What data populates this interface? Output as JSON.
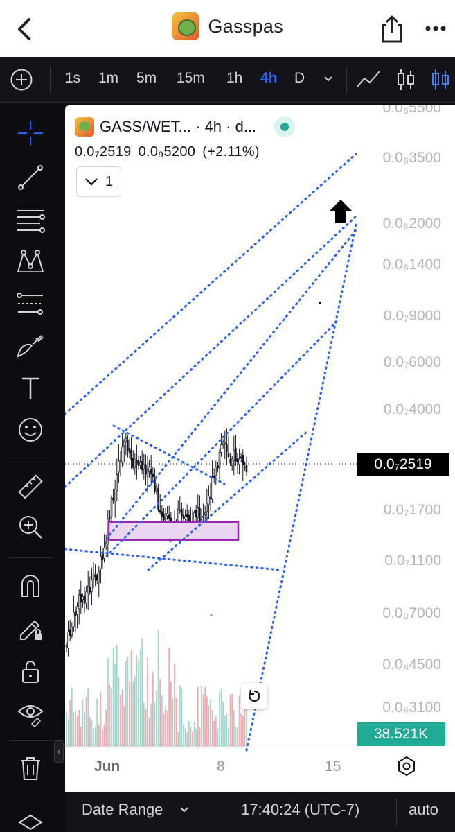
{
  "nav": {
    "title": "Gasspas",
    "back_icon": "chevron-left-icon",
    "share_icon": "share-icon",
    "more_icon": "more-horizontal-icon"
  },
  "toolbar": {
    "timeframes": [
      "1s",
      "1m",
      "5m",
      "15m",
      "1h",
      "4h",
      "D"
    ],
    "active_timeframe": "4h",
    "accent_color": "#2962ff"
  },
  "left_tools": [
    "crosshair-icon",
    "trend-line-icon",
    "fib-retracement-icon",
    "pattern-icon",
    "prediction-icon",
    "brush-icon",
    "text-icon",
    "emoji-icon",
    "ruler-icon",
    "zoom-in-icon",
    "magnet-icon",
    "lock-drawing-icon",
    "unlock-icon",
    "eye-icon",
    "trash-icon"
  ],
  "legend": {
    "symbol": "GASS/WET... · 4h · d...",
    "last": "0.0₇2519",
    "change_abs": "0.0₉5200",
    "change_pct": "(+2.11%)",
    "indicator_count": "1"
  },
  "price_axis": {
    "ticks": [
      "0.0₆5500",
      "0.0₆3500",
      "0.0₆2000",
      "0.0₆1400",
      "0.0₇9000",
      "0.0₇6000",
      "0.0₇4000",
      "0.0₇1700",
      "0.0₇1100",
      "0.0₈7000",
      "0.0₈4500",
      "0.0₈3100"
    ],
    "scale": "log",
    "last_price_label": "0.0₇2519",
    "volume_label": "38.521K"
  },
  "time_axis": {
    "ticks": [
      "Jun",
      "8",
      "15"
    ]
  },
  "bottom": {
    "date_range": "Date Range",
    "time": "17:40:24 (UTC-7)",
    "scale_mode": "auto"
  },
  "colors": {
    "up": "#22ab94",
    "down": "#f23645",
    "volume_up": "#9fd9cf",
    "volume_down": "#f7a9b0",
    "drawing_lines": "#2962ff",
    "zone_border": "#9c27b0",
    "zone_fill": "#ead6f0"
  },
  "chart_data": {
    "type": "candlestick",
    "symbol": "GASS/WET...",
    "interval": "4h",
    "last": "0.0₇2519",
    "y_ticks": [
      "0.0₆5500",
      "0.0₆3500",
      "0.0₆2000",
      "0.0₆1400",
      "0.0₇9000",
      "0.0₇6000",
      "0.0₇4000",
      "0.0₇1700",
      "0.0₇1100",
      "0.0₈7000",
      "0.0₈4500",
      "0.0₈3100"
    ],
    "x_ticks": [
      "Jun",
      "8",
      "15"
    ],
    "approx_close_path_e8": [
      5.5,
      9.0,
      11.0,
      13.5,
      30.0,
      20.0,
      16.0,
      12.5,
      14.0,
      16.0,
      24.0,
      25.0,
      22.0,
      25.2
    ]
  }
}
